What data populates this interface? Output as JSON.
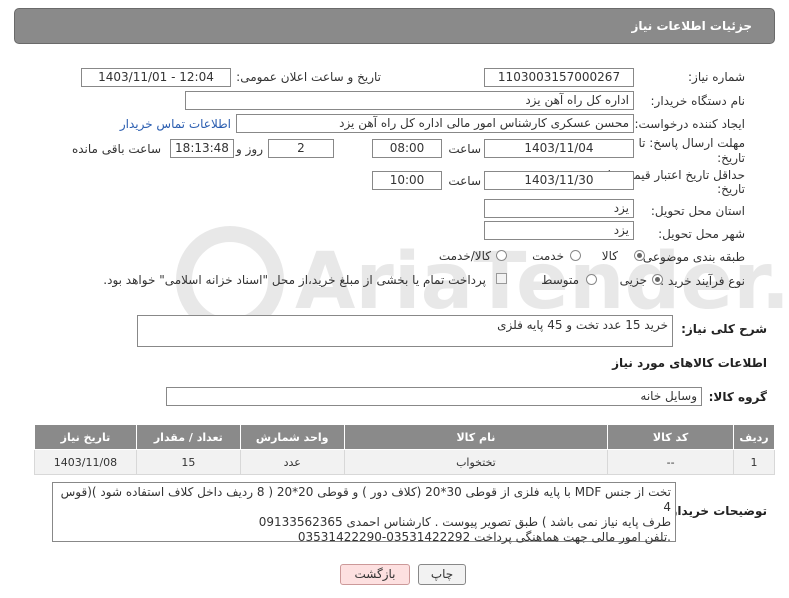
{
  "header": {
    "title": "جزئیات اطلاعات نیاز"
  },
  "form": {
    "need_number_label": "شماره نیاز:",
    "need_number": "1103003157000267",
    "announce_label": "تاریخ و ساعت اعلان عمومی:",
    "announce_value": "1403/11/01 - 12:04",
    "buyer_org_label": "نام دستگاه خریدار:",
    "buyer_org": "اداره کل راه آهن یزد",
    "requester_label": "ایجاد کننده درخواست:",
    "requester": "محسن عسکری کارشناس امور مالی اداره کل راه آهن یزد",
    "contact_link": "اطلاعات تماس خریدار",
    "deadline_label_1": "مهلت ارسال پاسخ: تا",
    "deadline_label_2": "تاریخ:",
    "deadline_date": "1403/11/04",
    "time_label": "ساعت",
    "deadline_time": "08:00",
    "days_value": "2",
    "days_label": "روز و",
    "remaining_time": "18:13:48",
    "remaining_label": "ساعت باقی مانده",
    "validity_label_1": "حداقل تاریخ اعتبار قیمت: تا",
    "validity_label_2": "تاریخ:",
    "validity_date": "1403/11/30",
    "validity_time": "10:00",
    "province_label": "استان محل تحویل:",
    "province": "یزد",
    "city_label": "شهر محل تحویل:",
    "city": "یزد",
    "category_label": "طبقه بندی موضوعی:",
    "category_options": [
      "کالا",
      "خدمت",
      "کالا/خدمت"
    ],
    "process_label": "نوع فرآیند خرید :",
    "process_options": [
      "جزیی",
      "متوسط"
    ],
    "payment_note": "پرداخت تمام یا بخشی از مبلغ خرید،از محل \"اسناد خزانه اسلامی\" خواهد بود."
  },
  "summary": {
    "label": "شرح کلی نیاز:",
    "text": "خرید 15 عدد تخت و 45 پایه فلزی"
  },
  "goods_info_title": "اطلاعات کالاهای مورد نیاز",
  "goods_group": {
    "label": "گروه کالا:",
    "value": "وسایل خانه"
  },
  "table": {
    "headers": [
      "ردیف",
      "کد کالا",
      "نام کالا",
      "واحد شمارش",
      "تعداد / مقدار",
      "تاریخ نیاز"
    ],
    "rows": [
      [
        "1",
        "--",
        "تختخواب",
        "عدد",
        "15",
        "1403/11/08"
      ]
    ]
  },
  "buyer_notes": {
    "label": "توضیحات خریدار:",
    "lines": [
      "تخت از جنس MDF با پایه فلزی از قوطی 30*20 (کلاف دور ) و قوطی 20*20 ( 8 ردیف داخل کلاف استفاده شود )(قوس 4",
      "طرف پایه نیاز نمی باشد ) طبق تصویر پیوست . کارشناس  احمدی 09133562365",
      ".تلفن امور مالی جهت هماهنگی پرداخت 03531422292-03531422290"
    ]
  },
  "buttons": {
    "print": "چاپ",
    "back": "بازگشت"
  },
  "watermark": {
    "text": "AriaTender.net"
  }
}
